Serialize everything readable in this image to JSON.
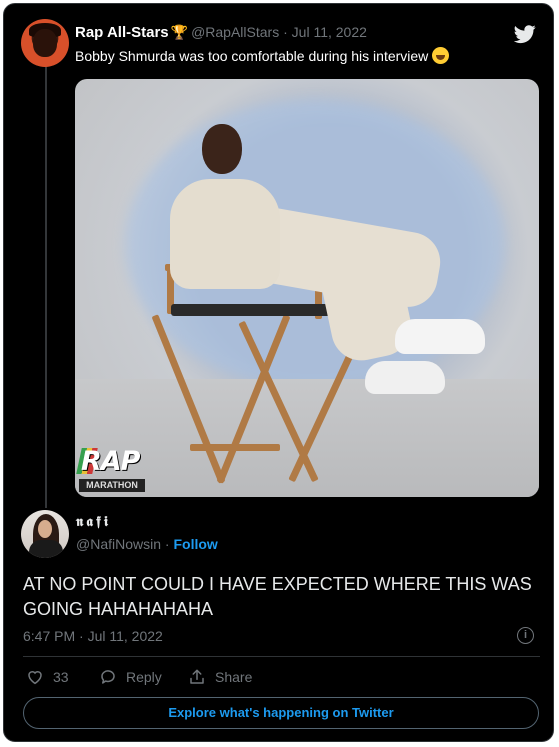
{
  "quoted": {
    "name": "Rap All-Stars",
    "badge_icon": "trophy-icon",
    "handle": "@RapAllStars",
    "separator": "·",
    "date": "Jul 11, 2022",
    "text": "Bobby Shmurda was too comfortable during his interview",
    "emoji_icon": "rolling-laughing-emoji-icon",
    "media_logo": {
      "word": "RAP",
      "sub": "MARATHON"
    }
  },
  "tweet": {
    "name": "𝖓𝖆𝖋𝖎",
    "handle": "@NafiNowsin",
    "separator": "·",
    "follow_label": "Follow",
    "text": "AT NO POINT COULD I HAVE EXPECTED WHERE THIS WAS GOING HAHAHAHAHA",
    "timestamp": "6:47 PM · Jul 11, 2022",
    "info_icon_glyph": "i"
  },
  "actions": {
    "like_count": "33",
    "reply_label": "Reply",
    "share_label": "Share"
  },
  "explore_label": "Explore what's happening on Twitter",
  "colors": {
    "background": "#000000",
    "text": "#e7e9ea",
    "muted": "#71767b",
    "accent": "#1d9bf0",
    "border": "#2f3336"
  }
}
